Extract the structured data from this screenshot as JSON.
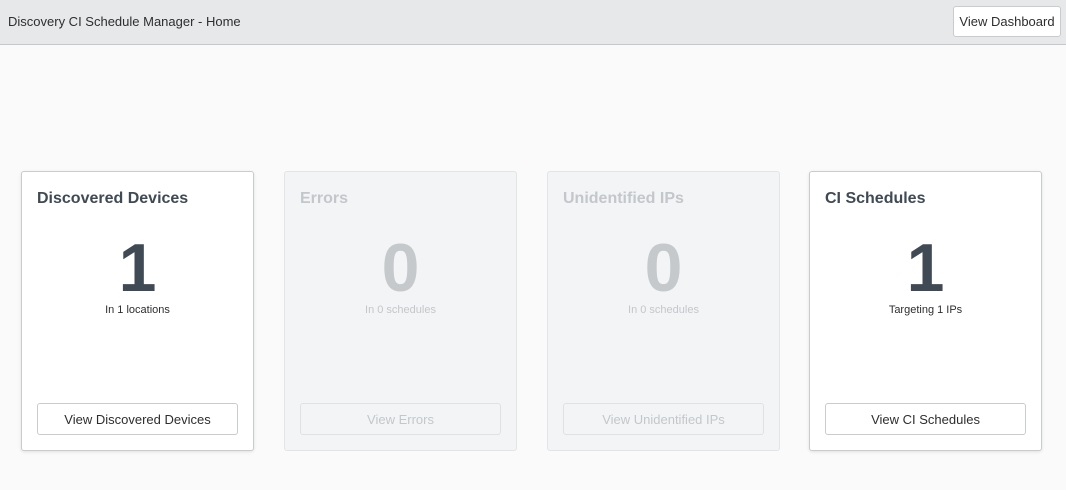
{
  "header": {
    "title": "Discovery CI Schedule Manager - Home",
    "dashboard_button": "View Dashboard"
  },
  "cards": [
    {
      "title": "Discovered Devices",
      "count": "1",
      "subtitle": "In 1 locations",
      "button": "View Discovered Devices",
      "enabled": true
    },
    {
      "title": "Errors",
      "count": "0",
      "subtitle": "In 0 schedules",
      "button": "View Errors",
      "enabled": false
    },
    {
      "title": "Unidentified IPs",
      "count": "0",
      "subtitle": "In 0 schedules",
      "button": "View Unidentified IPs",
      "enabled": false
    },
    {
      "title": "CI Schedules",
      "count": "1",
      "subtitle": "Targeting 1 IPs",
      "button": "View CI Schedules",
      "enabled": true
    }
  ]
}
